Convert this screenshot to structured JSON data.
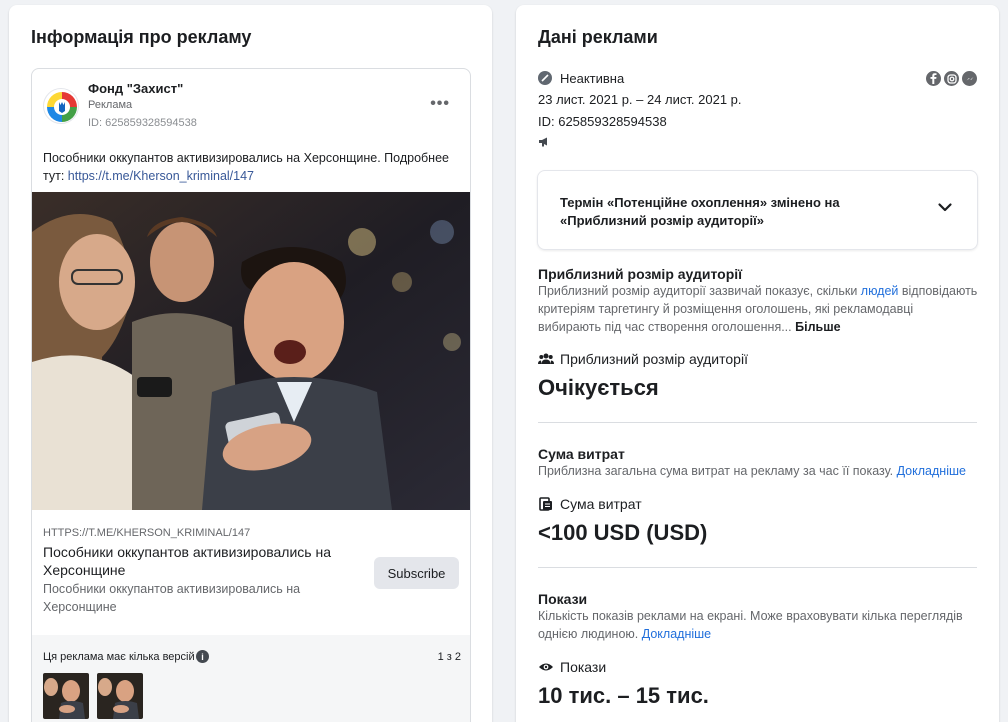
{
  "left_panel": {
    "title": "Інформація про рекламу",
    "ad": {
      "page_name": "Фонд \"Захист\"",
      "sponsored": "Реклама",
      "id_line": "ID: 625859328594538",
      "more_label": "•••",
      "text_prefix": "Пособники оккупантов активизировались на Херсонщине. Подробнее тут: ",
      "text_link": "https://t.me/Kherson_kriminal/147",
      "link_domain": "HTTPS://T.ME/KHERSON_KRIMINAL/147",
      "headline": "Пособники оккупантов активизировались на Херсонщине",
      "description": "Пособники оккупантов активизировались на Херсонщине",
      "cta_label": "Subscribe"
    },
    "versions": {
      "label": "Ця реклама має кілька версій",
      "info_icon": "i",
      "count": "1 з 2"
    }
  },
  "right_panel": {
    "title": "Дані реклами",
    "status": "Неактивна",
    "date_range": "23 лист. 2021 р. – 24 лист. 2021 р.",
    "id_line": "ID: 625859328594538",
    "platform_icons": [
      "facebook-icon",
      "instagram-icon",
      "messenger-icon"
    ],
    "notice": "Термін «Потенційне охоплення» змінено на «Приблизний розмір аудиторії»",
    "audience": {
      "title": "Приблизний розмір аудиторії",
      "desc_prefix": "Приблизний розмір аудиторії зазвичай показує, скільки ",
      "desc_link": "людей",
      "desc_suffix": " відповідають критеріям таргетингу й розміщення оголошень, які рекламодавці вибирають під час створення оголошення... ",
      "desc_more": "Більше",
      "metric_label": "Приблизний розмір аудиторії",
      "metric_value": "Очікується"
    },
    "spend": {
      "title": "Сума витрат",
      "desc_prefix": "Приблизна загальна сума витрат на рекламу за час її показу. ",
      "desc_link": "Докладніше",
      "metric_label": "Сума витрат",
      "metric_value": "<100 USD (USD)"
    },
    "impressions": {
      "title": "Покази",
      "desc_prefix": "Кількість показів реклами на екрані. Може враховувати кілька переглядів однією людиною. ",
      "desc_link": "Докладніше",
      "metric_label": "Покази",
      "metric_value": "10 тис. – 15 тис."
    }
  }
}
